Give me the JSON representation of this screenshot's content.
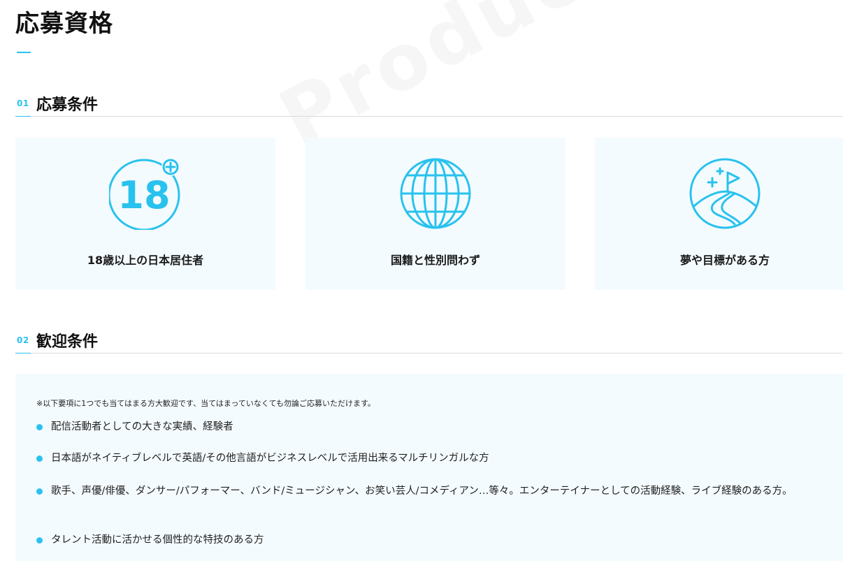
{
  "watermark": "Production Audition",
  "page_title": "応募資格",
  "sections": [
    {
      "number": "01",
      "title": "応募条件",
      "cards": [
        {
          "icon": "age-18-plus-icon",
          "icon_text": "18",
          "label": "18歳以上の日本居住者"
        },
        {
          "icon": "globe-icon",
          "label": "国籍と性別問わず"
        },
        {
          "icon": "mountain-flag-icon",
          "label": "夢や目標がある方"
        }
      ]
    },
    {
      "number": "02",
      "title": "歓迎条件",
      "note": "※以下要項に1つでも当てはまる方大歓迎です、当てはまっていなくても勿論ご応募いただけます。",
      "items": [
        "配信活動者としての大きな実績、経験者",
        "日本語がネイティブレベルで英語/その他言語がビジネスレベルで活用出来るマルチリンガルな方",
        "歌手、声優/俳優、ダンサー/パフォーマー、バンド/ミュージシャン、お笑い芸人/コメディアン…等々。エンターテイナーとしての活動経験、ライブ経験のある方。",
        "タレント活動に活かせる個性的な特技のある方"
      ]
    }
  ],
  "colors": {
    "accent": "#29c2ee",
    "card_bg": "#f4fbfe",
    "text": "#1a1a1a"
  }
}
